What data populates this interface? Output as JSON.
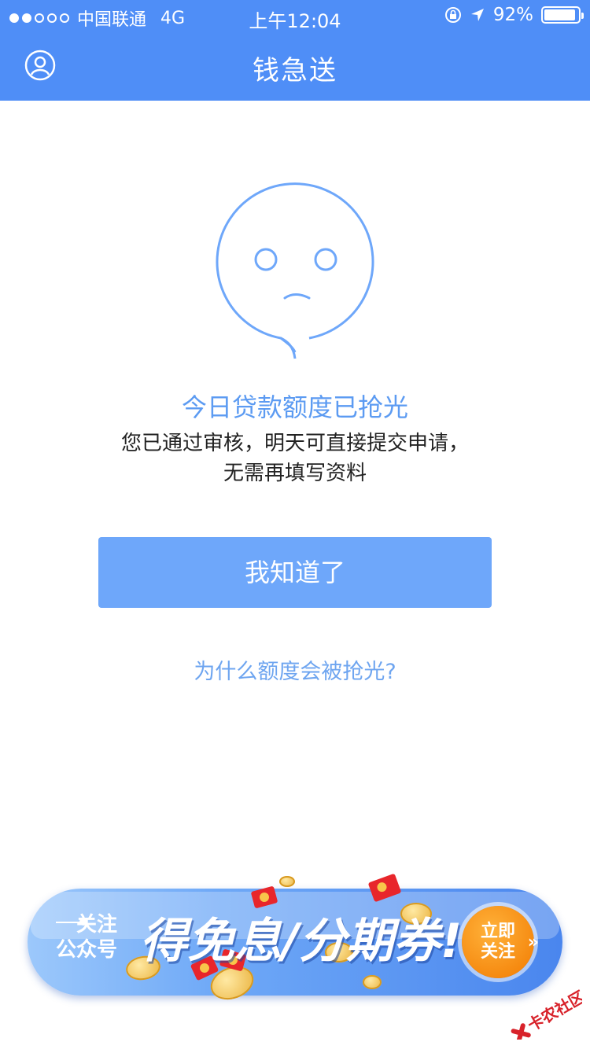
{
  "status_bar": {
    "carrier": "中国联通",
    "network": "4G",
    "time": "上午12:04",
    "battery": "92%",
    "battery_level": 0.92,
    "signal_bars_filled": 2,
    "signal_bars_total": 5
  },
  "nav": {
    "title": "钱急送",
    "profile_icon": "user-circle-icon"
  },
  "message": {
    "title": "今日贷款额度已抢光",
    "body_line1": "您已通过审核，明天可直接提交申请，",
    "body_line2": "无需再填写资料"
  },
  "actions": {
    "ok_label": "我知道了",
    "why_link": "为什么额度会被抢光?"
  },
  "banner": {
    "follow_line1": "关注",
    "follow_line2": "公众号",
    "headline": "得免息/分期券!",
    "cta_line1": "立即",
    "cta_line2": "关注"
  },
  "watermark": {
    "text": "卡农社区"
  },
  "colors": {
    "primary": "#4f8ef7",
    "button": "#6ea7fa",
    "accent_text": "#5c9bf2",
    "cta_orange": "#f27a00"
  }
}
